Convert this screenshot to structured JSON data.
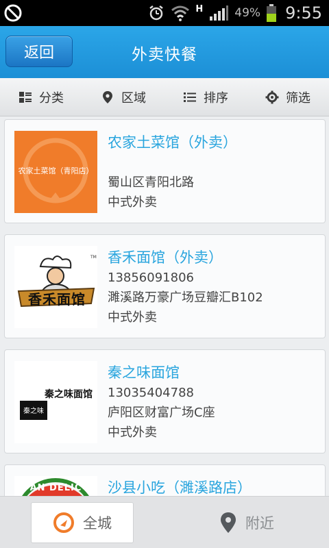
{
  "status_bar": {
    "network_type": "H",
    "battery_percent": "49%",
    "time": "9:55",
    "icons": [
      "blocked-icon",
      "alarm-icon",
      "wifi-icon",
      "signal-icon",
      "battery-icon"
    ]
  },
  "header": {
    "back_label": "返回",
    "title": "外卖快餐"
  },
  "filters": [
    {
      "label": "分类",
      "icon": "grid-icon"
    },
    {
      "label": "区域",
      "icon": "location-pin-icon"
    },
    {
      "label": "排序",
      "icon": "list-icon"
    },
    {
      "label": "筛选",
      "icon": "gear-icon"
    }
  ],
  "restaurants": [
    {
      "name": "农家土菜馆（外卖）",
      "logo_text": "农家土菜馆（青阳店）",
      "lines": [
        "",
        "蜀山区青阳北路",
        "中式外卖"
      ]
    },
    {
      "name": "香禾面馆（外卖）",
      "logo_text": "香禾面馆",
      "lines": [
        "13856091806",
        "濉溪路万豪广场豆瓣汇B102",
        "中式外卖"
      ]
    },
    {
      "name": "秦之味面馆",
      "logo_text": "秦之味面馆",
      "logo_seal": "秦之味",
      "lines": [
        "13035404788",
        "庐阳区财富广场C座",
        "中式外卖"
      ]
    },
    {
      "name": "沙县小吃（濉溪路店）",
      "logo_text": "AN DELIC",
      "lines": []
    }
  ],
  "bottom_nav": [
    {
      "label": "全城",
      "icon": "city-icon",
      "active": true
    },
    {
      "label": "附近",
      "icon": "location-pin-icon",
      "active": false
    }
  ],
  "colors": {
    "accent": "#29a5de",
    "header": "#1c8fd6",
    "orange": "#f07c2a"
  }
}
